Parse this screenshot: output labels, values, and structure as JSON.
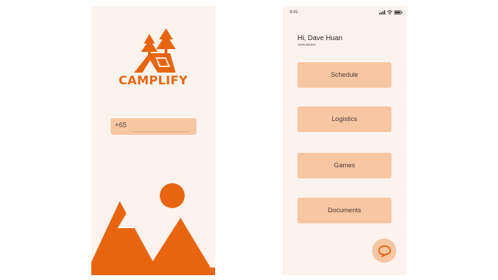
{
  "colors": {
    "brand": "#e8650f",
    "button": "#f7c6a3",
    "background": "#fdf3ee"
  },
  "login": {
    "brand_name": "CAMPLIFY",
    "phone_prefix": "+65"
  },
  "home": {
    "status_time": "9:41",
    "greeting": "Hi, Dave Huan",
    "role": "Administrator",
    "menu": [
      {
        "label": "Schedule"
      },
      {
        "label": "Logistics"
      },
      {
        "label": "Games"
      },
      {
        "label": "Documents"
      }
    ],
    "chat_icon": "chat-bubble-icon"
  }
}
